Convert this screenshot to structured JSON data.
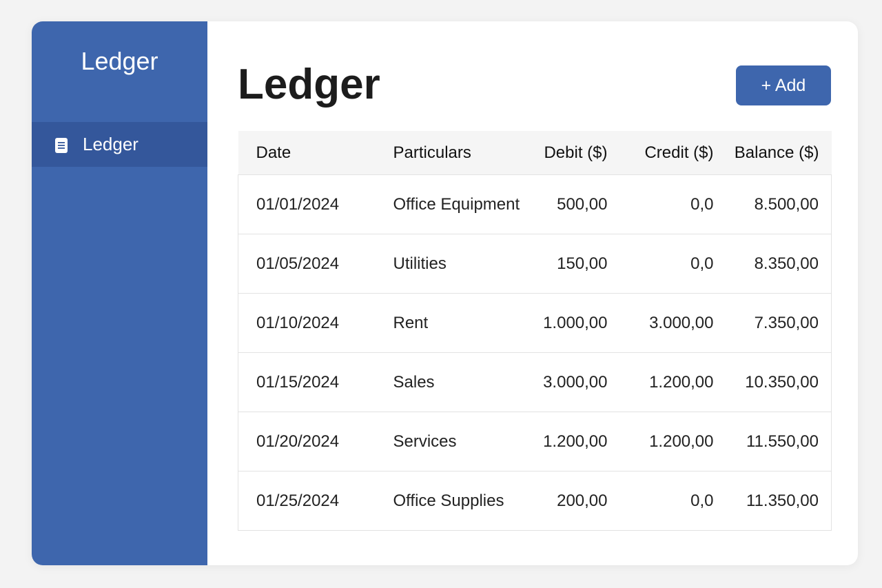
{
  "sidebar": {
    "brand": "Ledger",
    "items": [
      {
        "label": "Ledger",
        "icon": "document-icon",
        "active": true
      }
    ]
  },
  "main": {
    "title": "Ledger",
    "add_button_label": "+ Add"
  },
  "table": {
    "headers": [
      "Date",
      "Particulars",
      "Debit ($)",
      "Credit ($)",
      "Balance ($)"
    ],
    "rows": [
      [
        "01/01/2024",
        "Office Equipment",
        "500,00",
        "0,0",
        "8.500,00"
      ],
      [
        "01/05/2024",
        "Utilities",
        "150,00",
        "0,0",
        "8.350,00"
      ],
      [
        "01/10/2024",
        "Rent",
        "1.000,00",
        "3.000,00",
        "7.350,00"
      ],
      [
        "01/15/2024",
        "Sales",
        "3.000,00",
        "1.200,00",
        "10.350,00"
      ],
      [
        "01/20/2024",
        "Services",
        "1.200,00",
        "1.200,00",
        "11.550,00"
      ],
      [
        "01/25/2024",
        "Office Supplies",
        "200,00",
        "0,0",
        "11.350,00"
      ]
    ]
  },
  "colors": {
    "accent": "#3e66ad",
    "sidebar_active": "#34579b"
  }
}
